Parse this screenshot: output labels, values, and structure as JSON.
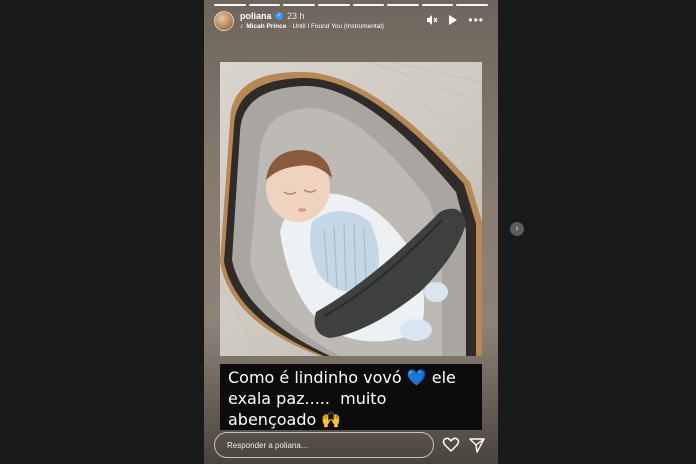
{
  "story": {
    "progress": {
      "total_segments": 8,
      "current_segment": 8
    },
    "user": {
      "name": "poliana",
      "time": "23 h"
    },
    "music": {
      "artist": "Micah Prince",
      "separator": "·",
      "track": "Until I Found You (Instrumental)"
    },
    "caption": {
      "line1": "Como é lindinho vovó",
      "line1_emoji": "💙",
      "line1_end": "ele",
      "line2": "exala paz.....  muito",
      "line3": "abençoado",
      "line3_emoji": "🙌"
    },
    "reply_placeholder": "Responder a poliana..."
  },
  "icons": {
    "verified": "verified-badge-icon",
    "mute": "speaker-muted-icon",
    "play": "play-icon",
    "more": "more-dots-icon",
    "like": "heart-icon",
    "send": "send-paper-plane-icon",
    "next": "chevron-right-icon"
  },
  "colors": {
    "background": "#1a1a1a",
    "caption_bg": "#0c0c0c",
    "heart": "#5aa7ff",
    "verified": "#3897f0"
  }
}
